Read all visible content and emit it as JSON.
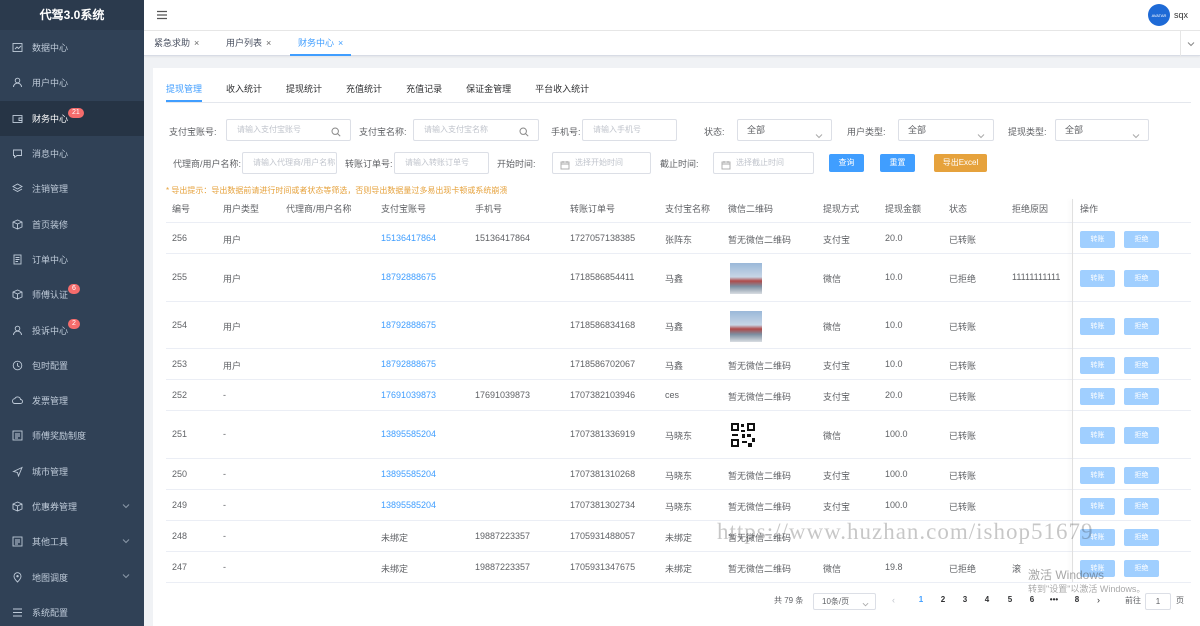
{
  "app": {
    "title": "代驾3.0系统"
  },
  "sidebar": {
    "items": [
      {
        "label": "数据中心",
        "badge": "",
        "arrow": false
      },
      {
        "label": "用户中心",
        "badge": "",
        "arrow": false
      },
      {
        "label": "财务中心",
        "badge": "21",
        "arrow": false
      },
      {
        "label": "消息中心",
        "badge": "",
        "arrow": false
      },
      {
        "label": "注销管理",
        "badge": "",
        "arrow": false
      },
      {
        "label": "首页装修",
        "badge": "",
        "arrow": false
      },
      {
        "label": "订单中心",
        "badge": "",
        "arrow": false
      },
      {
        "label": "师傅认证",
        "badge": "6",
        "arrow": false
      },
      {
        "label": "投诉中心",
        "badge": "2",
        "arrow": false
      },
      {
        "label": "包时配置",
        "badge": "",
        "arrow": false
      },
      {
        "label": "发票管理",
        "badge": "",
        "arrow": false
      },
      {
        "label": "师傅奖励制度",
        "badge": "",
        "arrow": false
      },
      {
        "label": "城市管理",
        "badge": "",
        "arrow": false
      },
      {
        "label": "优惠券管理",
        "badge": "",
        "arrow": true
      },
      {
        "label": "其他工具",
        "badge": "",
        "arrow": true
      },
      {
        "label": "地图调度",
        "badge": "",
        "arrow": true
      },
      {
        "label": "系统配置",
        "badge": "",
        "arrow": false
      }
    ]
  },
  "header": {
    "username": "sqx",
    "avatar_text": "AVATAR"
  },
  "tags": [
    {
      "label": "紧急求助",
      "close": "×"
    },
    {
      "label": "用户列表",
      "close": "×"
    },
    {
      "label": "财务中心",
      "close": "×"
    }
  ],
  "subtabs": [
    "提现管理",
    "收入统计",
    "提现统计",
    "充值统计",
    "充值记录",
    "保证金管理",
    "平台收入统计"
  ],
  "filters": {
    "alipay_account": {
      "label": "支付宝账号:",
      "placeholder": "请输入支付宝账号"
    },
    "alipay_name": {
      "label": "支付宝名称:",
      "placeholder": "请输入支付宝名称"
    },
    "phone": {
      "label": "手机号:",
      "placeholder": "请输入手机号"
    },
    "status": {
      "label": "状态:",
      "value": "全部"
    },
    "user_type": {
      "label": "用户类型:",
      "value": "全部"
    },
    "withdraw_type": {
      "label": "提现类型:",
      "value": "全部"
    },
    "agent": {
      "label": "代理商/用户名称:",
      "placeholder": "请输入代理商/用户名称"
    },
    "transfer_no": {
      "label": "转账订单号:",
      "placeholder": "请输入转账订单号"
    },
    "start_time": {
      "label": "开始时间:",
      "placeholder": "选择开始时间"
    },
    "end_time": {
      "label": "截止时间:",
      "placeholder": "选择截止时间"
    },
    "search_btn": "查询",
    "reset_btn": "重置",
    "export_btn": "导出Excel"
  },
  "hint": "* 导出提示：导出数据前请进行时间或者状态等筛选，否则导出数据量过多易出现卡顿或系统崩溃",
  "table": {
    "columns": [
      "编号",
      "用户类型",
      "代理商/用户名称",
      "支付宝账号",
      "手机号",
      "转账订单号",
      "支付宝名称",
      "微信二维码",
      "提现方式",
      "提现金额",
      "状态",
      "拒绝原因",
      "操作"
    ],
    "rows": [
      {
        "id": "256",
        "user_type": "用户",
        "agent": "",
        "alipay": "15136417864",
        "phone": "15136417864",
        "order_no": "1727057138385",
        "alipay_name": "张阵东",
        "qr": "暂无微信二维码",
        "qr_type": "text",
        "method": "支付宝",
        "amount": "20.0",
        "status": "已转账",
        "reason": ""
      },
      {
        "id": "255",
        "user_type": "用户",
        "agent": "",
        "alipay": "18792888675",
        "phone": "",
        "order_no": "1718586854411",
        "alipay_name": "马鑫",
        "qr": "",
        "qr_type": "photo",
        "method": "微信",
        "amount": "10.0",
        "status": "已拒绝",
        "reason": "11111111111"
      },
      {
        "id": "254",
        "user_type": "用户",
        "agent": "",
        "alipay": "18792888675",
        "phone": "",
        "order_no": "1718586834168",
        "alipay_name": "马鑫",
        "qr": "",
        "qr_type": "photo",
        "method": "微信",
        "amount": "10.0",
        "status": "已转账",
        "reason": ""
      },
      {
        "id": "253",
        "user_type": "用户",
        "agent": "",
        "alipay": "18792888675",
        "phone": "",
        "order_no": "1718586702067",
        "alipay_name": "马鑫",
        "qr": "暂无微信二维码",
        "qr_type": "text",
        "method": "支付宝",
        "amount": "10.0",
        "status": "已转账",
        "reason": ""
      },
      {
        "id": "252",
        "user_type": "-",
        "agent": "",
        "alipay": "17691039873",
        "phone": "17691039873",
        "order_no": "1707382103946",
        "alipay_name": "ces",
        "qr": "暂无微信二维码",
        "qr_type": "text",
        "method": "支付宝",
        "amount": "20.0",
        "status": "已转账",
        "reason": ""
      },
      {
        "id": "251",
        "user_type": "-",
        "agent": "",
        "alipay": "13895585204",
        "phone": "",
        "order_no": "1707381336919",
        "alipay_name": "马晓东",
        "qr": "",
        "qr_type": "qrcode",
        "method": "微信",
        "amount": "100.0",
        "status": "已转账",
        "reason": ""
      },
      {
        "id": "250",
        "user_type": "-",
        "agent": "",
        "alipay": "13895585204",
        "phone": "",
        "order_no": "1707381310268",
        "alipay_name": "马晓东",
        "qr": "暂无微信二维码",
        "qr_type": "text",
        "method": "支付宝",
        "amount": "100.0",
        "status": "已转账",
        "reason": ""
      },
      {
        "id": "249",
        "user_type": "-",
        "agent": "",
        "alipay": "13895585204",
        "phone": "",
        "order_no": "1707381302734",
        "alipay_name": "马晓东",
        "qr": "暂无微信二维码",
        "qr_type": "text",
        "method": "支付宝",
        "amount": "100.0",
        "status": "已转账",
        "reason": ""
      },
      {
        "id": "248",
        "user_type": "-",
        "agent": "",
        "alipay": "未绑定",
        "phone": "19887223357",
        "order_no": "1705931488057",
        "alipay_name": "未绑定",
        "qr": "暂无微信二维码",
        "qr_type": "text",
        "method": "",
        "amount": "",
        "status": "",
        "reason": ""
      },
      {
        "id": "247",
        "user_type": "-",
        "agent": "",
        "alipay": "未绑定",
        "phone": "19887223357",
        "order_no": "1705931347675",
        "alipay_name": "未绑定",
        "qr": "暂无微信二维码",
        "qr_type": "text",
        "method": "微信",
        "amount": "19.8",
        "status": "已拒绝",
        "reason": "滚"
      }
    ],
    "action_transfer": "转账",
    "action_reject": "拒绝"
  },
  "pagination": {
    "total": "共 79 条",
    "page_size": "10条/页",
    "pages": [
      "1",
      "2",
      "3",
      "4",
      "5",
      "6",
      "•••",
      "8"
    ],
    "current": "1",
    "goto_label": "前往",
    "goto_value": "1",
    "goto_suffix": "页"
  },
  "overlay": {
    "watermark": "https://www.huzhan.com/ishop51679",
    "win_title": "激活 Windows",
    "win_sub": "转到\"设置\"以激活 Windows。"
  },
  "colors": {
    "sidebar_bg": "#304156",
    "accent": "#409eff",
    "warning": "#e6a23c",
    "badge": "#f56c6c"
  }
}
